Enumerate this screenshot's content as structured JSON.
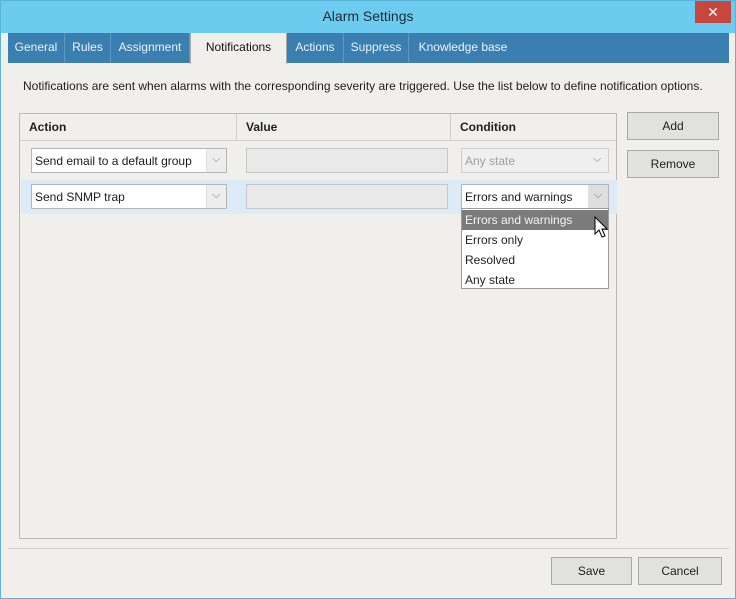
{
  "window": {
    "title": "Alarm Settings",
    "close_glyph": "✕"
  },
  "tabs": [
    {
      "label": "General",
      "active": false
    },
    {
      "label": "Rules",
      "active": false
    },
    {
      "label": "Assignment",
      "active": false
    },
    {
      "label": "Notifications",
      "active": true
    },
    {
      "label": "Actions",
      "active": false
    },
    {
      "label": "Suppress",
      "active": false
    },
    {
      "label": "Knowledge base",
      "active": false
    }
  ],
  "description": "Notifications are sent when alarms with the corresponding severity are triggered. Use the list below to define notification options.",
  "grid": {
    "columns": [
      "Action",
      "Value",
      "Condition"
    ],
    "rows": [
      {
        "action": "Send email to a default group",
        "value": "",
        "condition": "Any state",
        "condition_enabled": false
      },
      {
        "action": "Send SNMP trap",
        "value": "",
        "condition": "Errors and warnings",
        "condition_enabled": true,
        "selected": true
      }
    ]
  },
  "condition_dropdown": {
    "options": [
      "Errors and warnings",
      "Errors only",
      "Resolved",
      "Any state"
    ],
    "highlighted_index": 0
  },
  "side_buttons": {
    "add": "Add",
    "remove": "Remove"
  },
  "footer": {
    "save": "Save",
    "cancel": "Cancel"
  },
  "icons": {
    "chevron": "chevron-down-icon",
    "cursor": "mouse-pointer-icon"
  },
  "colors": {
    "titlebar": "#6ccbee",
    "tabbar": "#3a7fb0",
    "close": "#c7463d",
    "selected_row": "#dcebf7",
    "highlight": "#7b7b7b"
  }
}
